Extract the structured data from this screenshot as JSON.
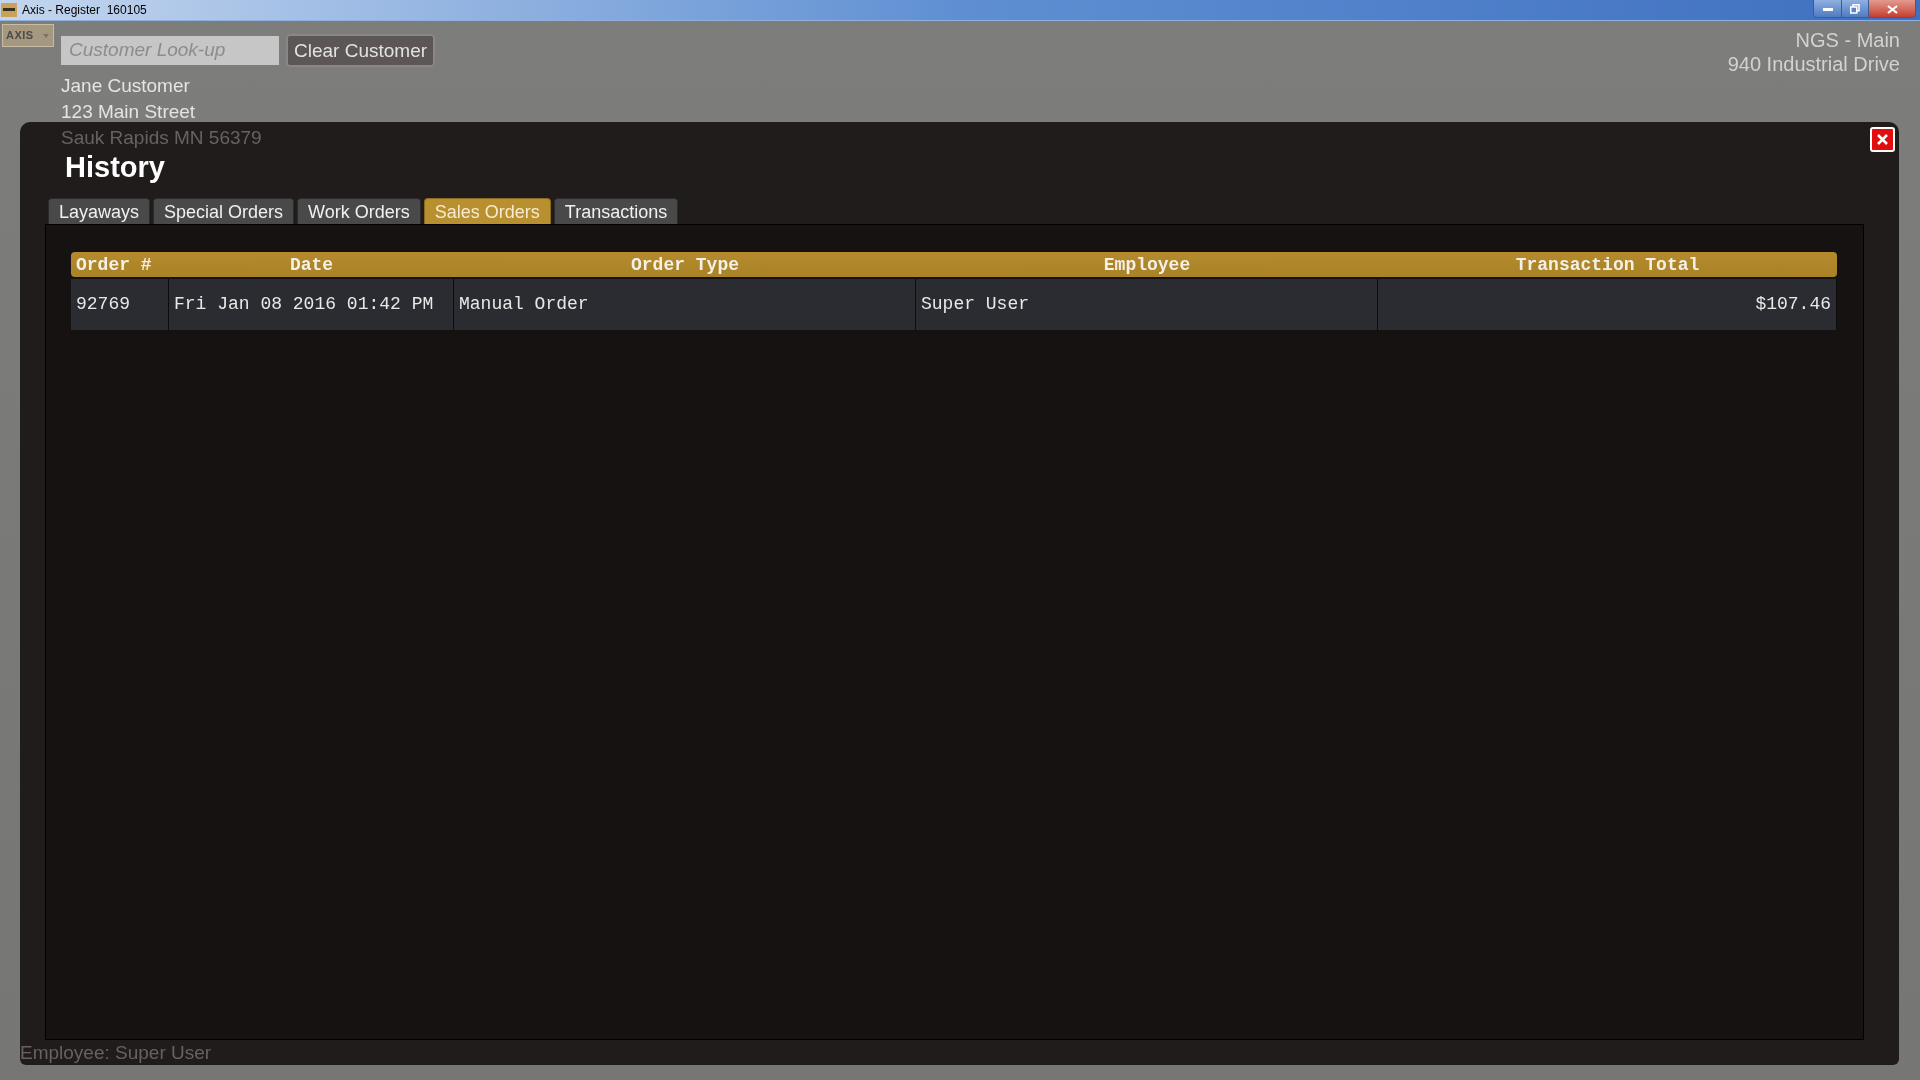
{
  "window": {
    "title": "Axis - Register  160105"
  },
  "app_menu": {
    "label": "AXIS"
  },
  "customer": {
    "search": {
      "placeholder": "Customer Look-up"
    },
    "clear_button": "Clear Customer",
    "name": "Jane Customer",
    "street": "123 Main Street",
    "city_line": "Sauk Rapids MN 56379"
  },
  "store": {
    "name": "NGS - Main",
    "address": "940 Industrial Drive"
  },
  "dialog": {
    "title": "History",
    "tabs": [
      {
        "label": "Layaways",
        "selected": false
      },
      {
        "label": "Special Orders",
        "selected": false
      },
      {
        "label": "Work Orders",
        "selected": false
      },
      {
        "label": "Sales Orders",
        "selected": true
      },
      {
        "label": "Transactions",
        "selected": false
      }
    ],
    "table": {
      "columns": [
        "Order #",
        "Date",
        "Order Type",
        "Employee",
        "Transaction Total"
      ],
      "rows": [
        [
          "92769",
          "Fri Jan 08 2016 01:42 PM",
          "Manual Order",
          "Super User",
          "$107.46"
        ]
      ]
    }
  },
  "status": {
    "employee": "Employee: Super User"
  }
}
